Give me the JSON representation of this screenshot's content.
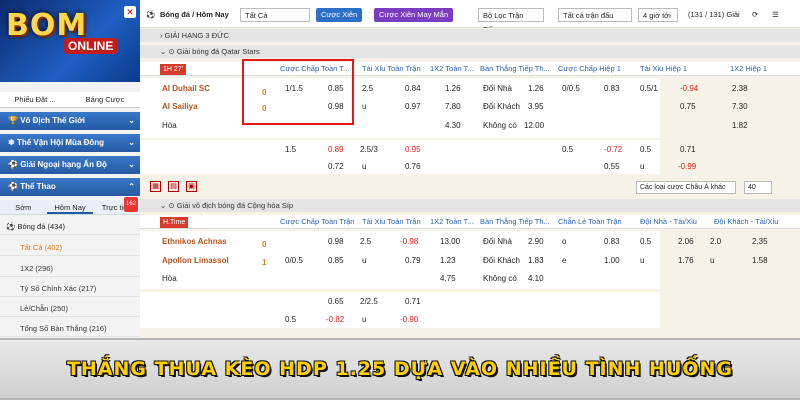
{
  "logo": {
    "main": "BOM",
    "sub": "ONLINE"
  },
  "sidebar": {
    "tabs": [
      "Phiếu Đặt ...",
      "Bảng Cược"
    ],
    "sections": [
      "Vô Địch Thế Giới",
      "Thế Vận Hội Mùa Đông",
      "Giải Ngoại hạng Ấn Độ",
      "Thể Thao"
    ],
    "subtabs": [
      "Sớm",
      "Hôm Nay",
      "Trực tiếp"
    ],
    "badge": "162",
    "items": [
      "Bóng đá (434)",
      "Tất Cả (402)",
      "1X2 (296)",
      "Tỷ Số Chính Xác (217)",
      "Lẻ/Chẵn (250)",
      "Tổng Số Bàn Thắng (216)"
    ]
  },
  "topbar": {
    "crumb": "Bóng đá / Hôm Nay",
    "filter": "Tất Cả",
    "btn1": "Cược Xiên",
    "btn2": "Cược Xiên May Mắn",
    "match_filter": "Bộ Lọc Trận Đấu",
    "all_matches": "Tất cả trận đấu",
    "hours": "4 giờ tới",
    "count": "(131 / 131) Giải"
  },
  "league_top": "GIẢI HẠNG 3 ĐỨC",
  "leagues": [
    {
      "name": "Giải bóng đá Qatar Stars",
      "time": "1H 27'",
      "headers": [
        "Cược Chấp Toàn T...",
        "Tài Xỉu Toàn Trận",
        "1X2 Toàn T...",
        "Bàn Thắng Tiếp Th...",
        "Cược Chấp Hiệp 1",
        "Tài Xỉu Hiệp 1",
        "1X2 Hiệp 1"
      ],
      "home": "Al Duhail SC",
      "away": "Al Sailiya",
      "draw": "Hòa",
      "home_score": "0",
      "away_score": "0",
      "r1": [
        "1/1.5",
        "0.85",
        "2.5",
        "0.84",
        "1.26",
        "Đối Nhà",
        "1.26",
        "0/0.5",
        "0.83",
        "0.5/1",
        "-0.94",
        "2.38"
      ],
      "r2": [
        "0.98",
        "u",
        "0.97",
        "7.80",
        "Đối Khách",
        "3.95",
        "0.75",
        "7.30"
      ],
      "r3": [
        "4.30",
        "Không có",
        "12.00",
        "1.82"
      ],
      "r4": [
        "1.5",
        "0.89",
        "2.5/3",
        "0.95",
        "0.5",
        "-0.72",
        "0.5",
        "0.71"
      ],
      "r5": [
        "0.72",
        "u",
        "0.76",
        "0.55",
        "u",
        "-0.99"
      ]
    },
    {
      "name": "Giải vô địch bóng đá Cộng hòa Síp",
      "time": "H.Time",
      "headers": [
        "Cược Chấp Toàn Trận",
        "Tài Xỉu Toàn Trận",
        "1X2 Toàn T...",
        "Bàn Thắng Tiếp Th...",
        "Chẵn Lẻ Toàn Trận",
        "Đội Nhà - Tài/Xỉu",
        "Đội Khách - Tài/Xỉu"
      ],
      "home": "Ethnikos Achnas",
      "away": "Apollon Limassol",
      "draw": "Hòa",
      "home_score": "0",
      "away_score": "1",
      "r1": [
        "0.98",
        "2.5",
        "-0.98",
        "13.00",
        "Đối Nhà",
        "2.90",
        "o",
        "0.83",
        "0.5",
        "2.06",
        "2.0",
        "2.35"
      ],
      "r2": [
        "0/0.5",
        "0.85",
        "u",
        "0.79",
        "1.23",
        "Đối Khách",
        "1.83",
        "e",
        "1.00",
        "u",
        "1.76",
        "u",
        "1.58"
      ],
      "r3": [
        "4.75",
        "Không có",
        "4.10"
      ],
      "r4": [
        "0.65",
        "2/2.5",
        "0.71"
      ],
      "r5": [
        "0.5",
        "-0.82",
        "u",
        "-0.90"
      ]
    }
  ],
  "controls": {
    "currency": "Các loại cược Châu Á khác",
    "pagesize": "40"
  },
  "banner": "THẮNG THUA KÈO HDP 1.25 DỰA VÀO NHIỀU TÌNH HUỐNG"
}
